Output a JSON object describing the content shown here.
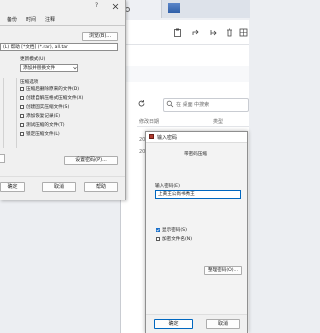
{
  "explorer": {
    "search_placeholder": "在 桌面 中搜索",
    "columns": {
      "date": "修改日期",
      "type": "类型"
    },
    "rows": [
      "20",
      "20"
    ]
  },
  "archive_dialog": {
    "tabs": [
      "备份",
      "时间",
      "注释"
    ],
    "browse_label": "浏览(B)...",
    "archive_name": "(L) 帮助 [*文档] (*.rar), all.tar",
    "update_mode_label": "更新模式(U)",
    "update_mode_value": "添加并替换文件",
    "options_label": "压缩选项",
    "options": [
      "压缩后删除原来的文件(D)",
      "创建自解压格式压缩文件(X)",
      "创建固实压缩文件(S)",
      "添加恢复记录(E)",
      "测试压缩的文件(T)",
      "锁定压缩文件(L)"
    ],
    "set_password_label": "设置密码(P)...",
    "ok": "确定",
    "cancel": "取消",
    "help": "帮助"
  },
  "password_dialog": {
    "title": "输入密码",
    "subtitle": "带密码压缩",
    "field_label": "输入密码(E)",
    "field_value": "上黄王公尚书秀王",
    "show_password": "显示密码(S)",
    "encrypt_names": "加密文件名(N)",
    "show_password_checked": true,
    "encrypt_names_checked": false,
    "organize_label": "整理密码(O)...",
    "ok": "确定",
    "cancel": "取消"
  }
}
